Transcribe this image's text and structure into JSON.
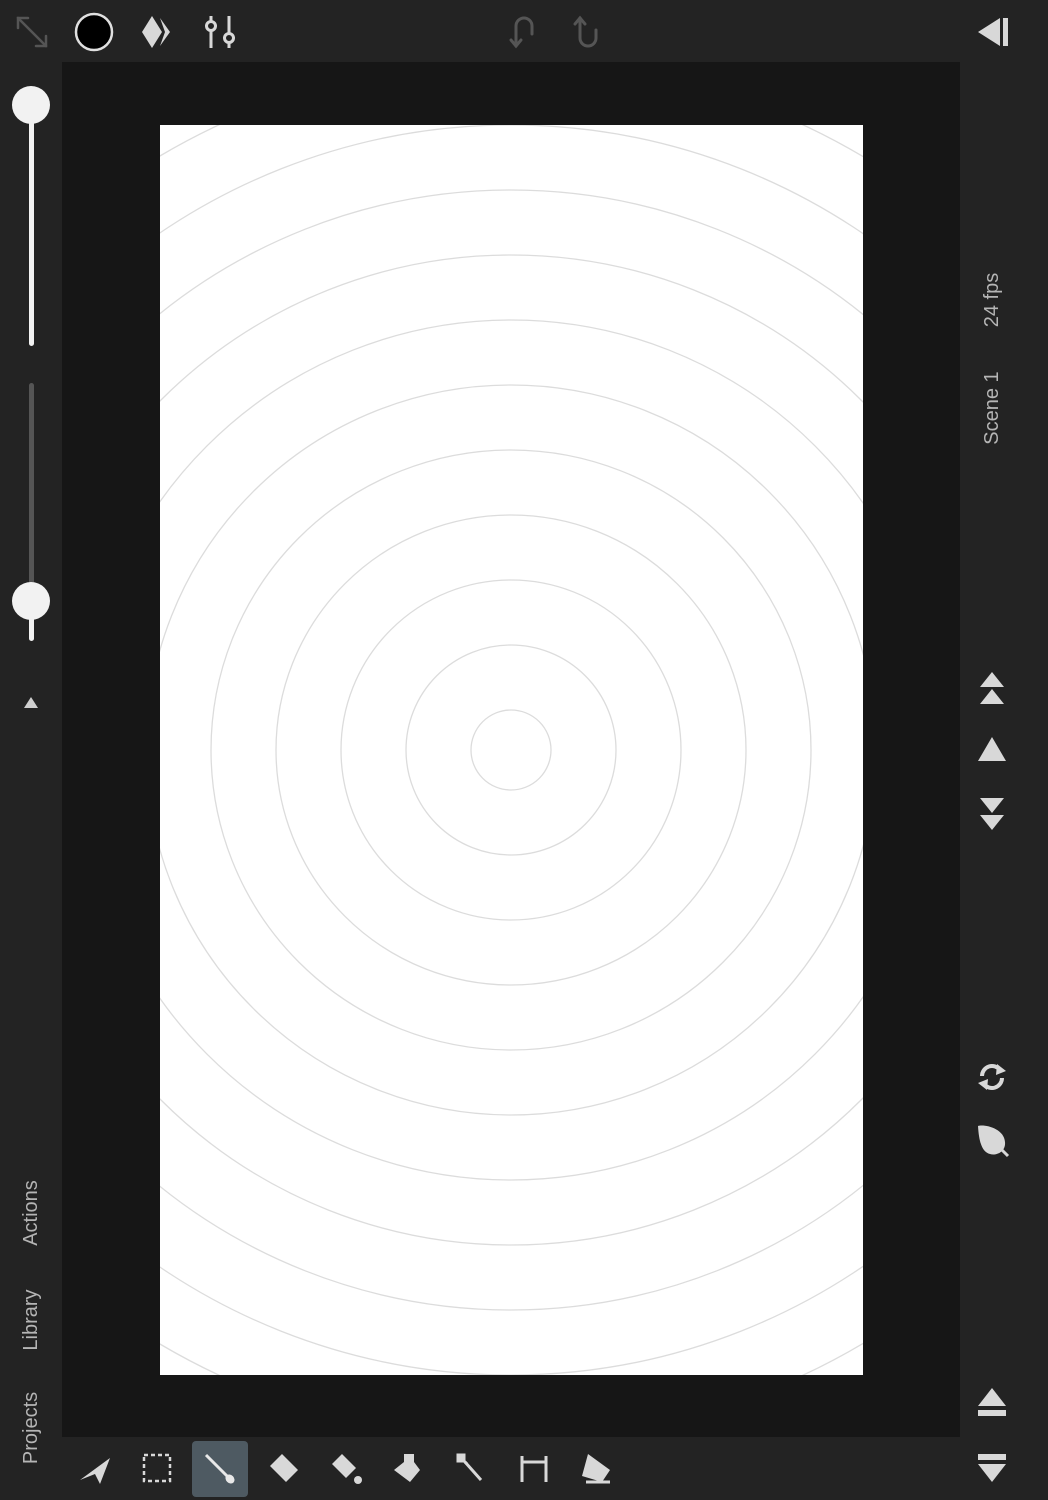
{
  "top_bar": {
    "icons": [
      "expand-icon",
      "color-swatch",
      "keyframe-icon",
      "sliders-icon",
      "undo-icon",
      "redo-icon",
      "collapse-panel-icon"
    ],
    "color_swatch": "#000000"
  },
  "left_panel": {
    "brush_size_level": 1.0,
    "opacity_level": 0.15,
    "tabs": {
      "actions": "Actions",
      "library": "Library",
      "projects": "Projects"
    }
  },
  "right_panel": {
    "fps": "24 fps",
    "scene": "Scene 1"
  },
  "bottom_toolbar": {
    "tools": [
      "move-tool",
      "select-tool",
      "brush-tool",
      "eraser-tool",
      "fill-tool",
      "smudge-tool",
      "eyedropper-tool",
      "text-tool",
      "pen-tool"
    ],
    "active_tool": "brush-tool"
  },
  "colors": {
    "background": "#232323",
    "workspace": "#161616",
    "canvas": "#ffffff",
    "active_tool": "#4e5a62",
    "onion_ring": "#dcdcdc"
  }
}
